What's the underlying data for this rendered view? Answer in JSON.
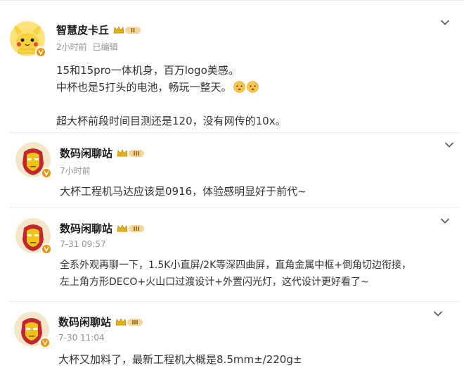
{
  "posts": [
    {
      "username": "智慧皮卡丘",
      "meta_time": "2小时前",
      "meta_edited": "已编辑",
      "lines": [
        "15和15pro一体机身，百万logo美感。",
        "中杯也是5打头的电池，畅玩一整天。",
        "",
        "超大杯前段时间目测还是120，没有网传的10x。"
      ],
      "emoji": "sweat-face-icon",
      "level": "II"
    },
    {
      "username": "数码闲聊站",
      "meta_time": "7小时前",
      "lines": [
        "大杯工程机马达应该是0916，体验感明显好于前代~"
      ],
      "level": "III"
    },
    {
      "username": "数码闲聊站",
      "meta_time": "7-31 09:57",
      "lines": [
        "全系外观再聊一下，1.5K小直屏/2K等深四曲屏，直角金属中框+倒角切边衔接，",
        "左上角方形DECO+火山口过渡设计+外置闪光灯，这代设计更好看了~"
      ],
      "level": "III"
    },
    {
      "username": "数码闲聊站",
      "meta_time": "7-30 11:04",
      "lines": [
        "大杯又加料了，最新工程机大概是8.5mm±/220g±"
      ],
      "level": "III"
    }
  ],
  "colors": {
    "verified_badge": "#f29100",
    "crown": "#e8b20e",
    "meta_text": "#939393"
  }
}
